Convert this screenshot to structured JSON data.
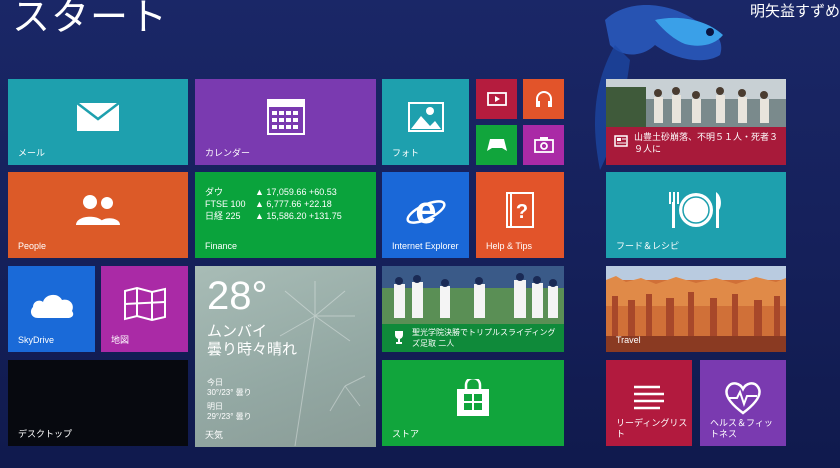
{
  "header": {
    "title": "スタート",
    "user_name": "明矢益すずめ"
  },
  "tiles": {
    "mail": {
      "label": "メール"
    },
    "calendar": {
      "label": "カレンダー"
    },
    "photos": {
      "label": "フォト"
    },
    "people": {
      "label": "People"
    },
    "finance": {
      "label": "Finance",
      "rows": [
        {
          "name": "ダウ",
          "value": "▲ 17,059.66 +60.53"
        },
        {
          "name": "FTSE 100",
          "value": "▲ 6,777.66 +22.18"
        },
        {
          "name": "日経 225",
          "value": "▲ 15,586.20 +131.75"
        }
      ]
    },
    "ie": {
      "label": "Internet Explorer"
    },
    "help": {
      "label": "Help & Tips"
    },
    "skydrive": {
      "label": "SkyDrive"
    },
    "maps": {
      "label": "地図"
    },
    "weather": {
      "temp": "28°",
      "city": "ムンバイ",
      "condition": "曇り時々晴れ",
      "today_label": "今日",
      "today_value": "30°/23° 曇り",
      "tomorrow_label": "明日",
      "tomorrow_value": "29°/23° 曇り",
      "label": "天気"
    },
    "sports": {
      "headline": "聖光学院決勝でトリプルスライディングズ足取 二人"
    },
    "desktop": {
      "label": "デスクトップ"
    },
    "store": {
      "label": "ストア"
    },
    "news": {
      "headline": "山豊土砂崩落、不明５１人・死者３９人に"
    },
    "food": {
      "label": "フード＆レシピ"
    },
    "travel": {
      "label": "Travel"
    },
    "reading": {
      "label": "リーディングリスト"
    },
    "health": {
      "label": "ヘルス＆フィットネス"
    }
  },
  "colors": {
    "background": "#17225c",
    "mail": "#1ea0ae",
    "calendar": "#7a3ab0",
    "photos": "#1ea0ae",
    "people": "#dc5a28",
    "finance": "#0aa33c",
    "ie": "#1a68d8",
    "help": "#e2542a",
    "skydrive": "#1a6ad8",
    "maps": "#aa2aa6",
    "weather": "#9fb2ad",
    "desktop": "#07090f",
    "store": "#11a53c",
    "news": "#a81a3a",
    "food": "#1ea0ae",
    "reading": "#b21a3e",
    "health": "#7a3ab0",
    "video": "#b51c3e",
    "music": "#e2542a",
    "games": "#11a53c",
    "camera": "#aa2aa6"
  }
}
